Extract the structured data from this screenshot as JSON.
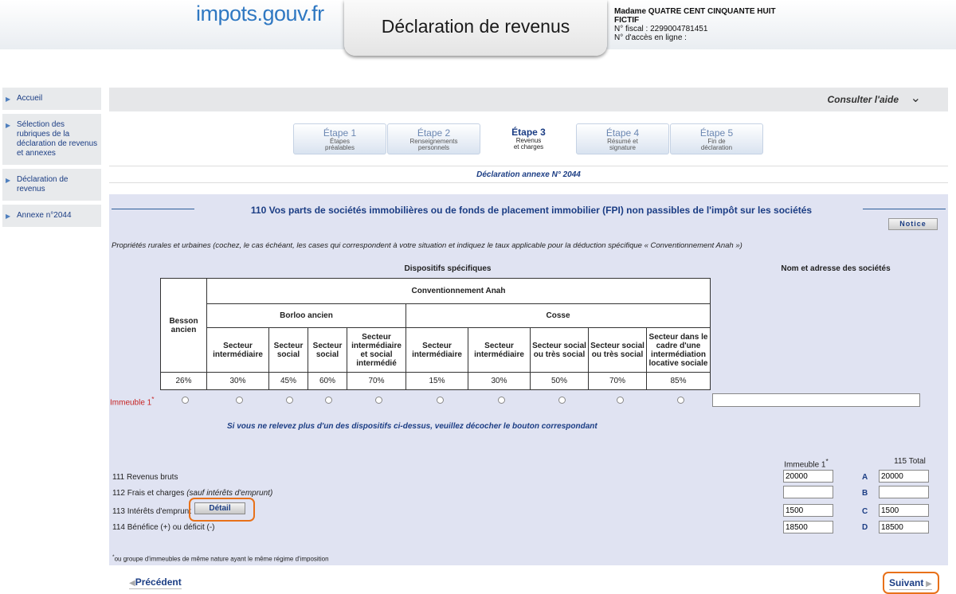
{
  "header": {
    "logo": "impots.gouv.fr",
    "title": "Déclaration de revenus",
    "user_name_1": "Madame QUATRE CENT CINQUANTE HUIT",
    "user_name_2": "FICTIF",
    "fiscal_number": "N° fiscal : 2299004781451",
    "access_number": "N° d'accès en ligne :"
  },
  "sidebar": {
    "items": [
      {
        "label": "Accueil"
      },
      {
        "label": "Sélection des rubriques de la déclaration de revenus et annexes"
      },
      {
        "label": "Déclaration de revenus"
      },
      {
        "label": "Annexe n°2044"
      }
    ]
  },
  "help": {
    "label": "Consulter l'aide"
  },
  "steps": [
    {
      "title": "Étape 1",
      "line1": "Étapes",
      "line2": "préalables"
    },
    {
      "title": "Étape 2",
      "line1": "Renseignements",
      "line2": "personnels"
    },
    {
      "title": "Étape 3",
      "line1": "Revenus",
      "line2": "et charges"
    },
    {
      "title": "Étape 4",
      "line1": "Résumé et",
      "line2": "signature"
    },
    {
      "title": "Étape 5",
      "line1": "Fin de",
      "line2": "déclaration"
    }
  ],
  "annex_title": "Déclaration annexe N° 2044",
  "section": {
    "title": "110 Vos parts de sociétés immobilières ou de fonds de placement immobilier (FPI) non passibles de l'impôt sur les sociétés",
    "notice_label": "Notice",
    "intro": "Propriétés rurales et urbaines (cochez, le cas échéant, les cases qui correspondent à votre situation et indiquez le taux applicable pour la déduction spécifique « Conventionnement Anah »)",
    "dispositifs_header": "Dispositifs spécifiques",
    "nom_header": "Nom et adresse des sociétés",
    "table": {
      "conventionnement": "Conventionnement Anah",
      "besson": "Besson ancien",
      "borloo": "Borloo ancien",
      "cosse": "Cosse",
      "secteurs": [
        "Secteur intermédiaire",
        "Secteur social",
        "Secteur social",
        "Secteur intermédiaire et social intermédié",
        "Secteur intermédiaire",
        "Secteur intermédiaire",
        "Secteur social ou très social",
        "Secteur social ou très social",
        "Secteur dans le cadre d'une intermédiation locative sociale"
      ],
      "rates": [
        "26%",
        "30%",
        "45%",
        "60%",
        "70%",
        "15%",
        "30%",
        "50%",
        "70%",
        "85%"
      ]
    },
    "immeuble_label": "Immeuble 1",
    "immeuble_star": "*",
    "name_value": "",
    "uncheck_note": "Si vous ne relevez plus d'un des dispositifs ci-dessus, veuillez décocher le bouton correspondant"
  },
  "financial": {
    "col_immeuble": "Immeuble 1",
    "col_star": "*",
    "col_total": "115 Total",
    "rows": [
      {
        "label": "111 Revenus bruts",
        "value": "20000",
        "letter": "A",
        "total": "20000"
      },
      {
        "label": "112 Frais et charges ",
        "label_italic": "(sauf intérêts d'emprunt)",
        "value": "",
        "letter": "B",
        "total": ""
      },
      {
        "label": "113 Intérêts d'emprunt",
        "value": "1500",
        "letter": "C",
        "total": "1500"
      },
      {
        "label": "114 Bénéfice (+) ou déficit (-)",
        "value": "18500",
        "letter": "D",
        "total": "18500"
      }
    ],
    "detail_label": "Détail",
    "footnote_star": "*",
    "footnote": "ou groupe d'immeubles de même nature ayant le même régime d'imposition"
  },
  "nav": {
    "prev": "Précédent",
    "next": "Suivant"
  },
  "colors": {
    "accent": "#1b3d84",
    "highlight": "#e8711a",
    "panel": "#e0e3f2"
  }
}
